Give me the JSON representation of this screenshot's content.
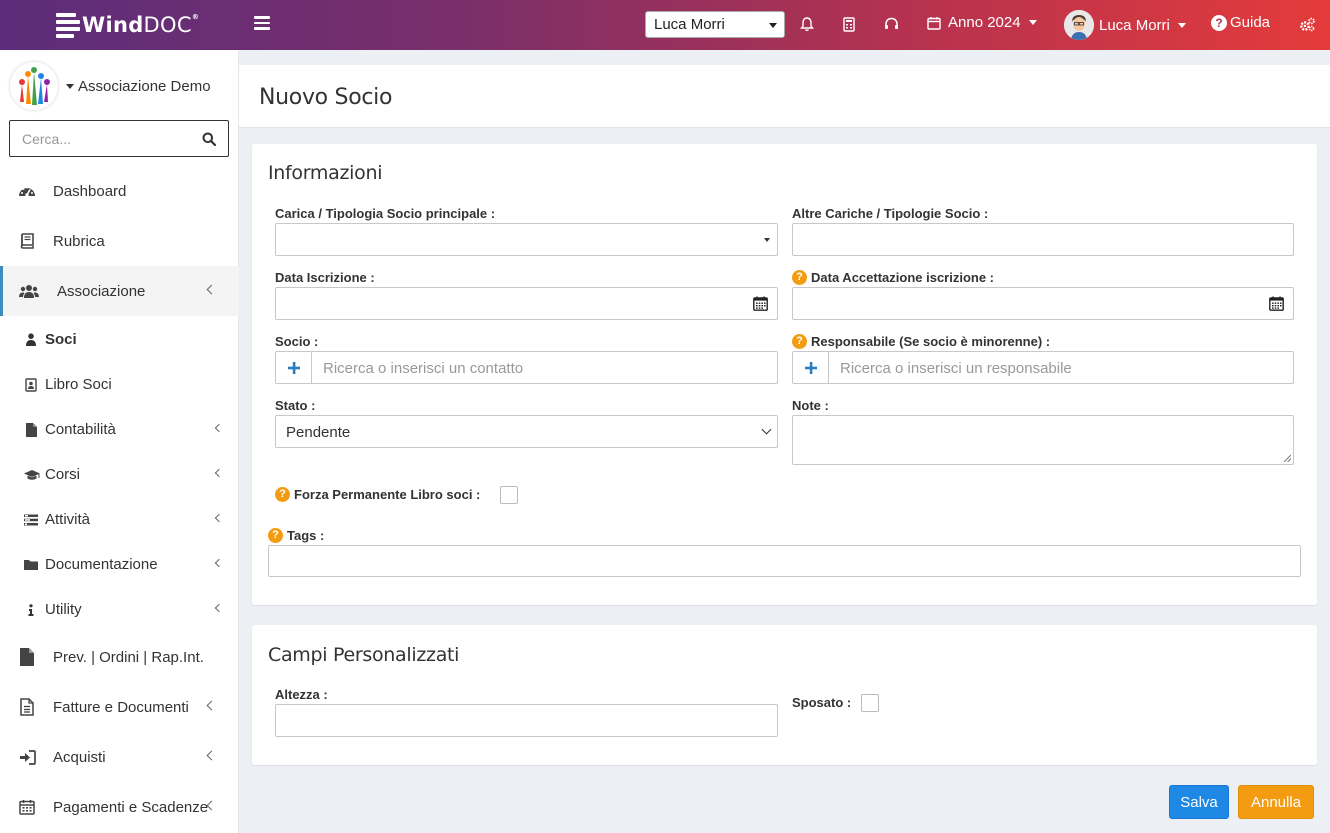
{
  "app": {
    "logo_main": "Wind",
    "logo_sub": "DOC",
    "logo_reg": "®"
  },
  "topbar": {
    "user_select_value": "Luca Morri",
    "year_label": "Anno 2024",
    "user_name": "Luca Morri",
    "help_label": "Guida"
  },
  "sidebar": {
    "org_name": "Associazione Demo",
    "search_placeholder": "Cerca...",
    "items": [
      {
        "label": "Dashboard"
      },
      {
        "label": "Rubrica"
      },
      {
        "label": "Associazione"
      },
      {
        "label": "Prev. | Ordini | Rap.Int."
      },
      {
        "label": "Fatture e Documenti"
      },
      {
        "label": "Acquisti"
      },
      {
        "label": "Pagamenti e Scadenze"
      }
    ],
    "sub_items": [
      {
        "label": "Soci"
      },
      {
        "label": "Libro Soci"
      },
      {
        "label": "Contabilità"
      },
      {
        "label": "Corsi"
      },
      {
        "label": "Attività"
      },
      {
        "label": "Documentazione"
      },
      {
        "label": "Utility"
      }
    ]
  },
  "page": {
    "title": "Nuovo Socio"
  },
  "info": {
    "title": "Informazioni",
    "carica_label": "Carica / Tipologia Socio principale :",
    "altre_label": "Altre Cariche / Tipologie Socio :",
    "data_iscr_label": "Data Iscrizione :",
    "data_acc_label": "Data Accettazione iscrizione :",
    "socio_label": "Socio :",
    "socio_placeholder": "Ricerca o inserisci un contatto",
    "resp_label": "Responsabile (Se socio è minorenne) :",
    "resp_placeholder": "Ricerca o inserisci un responsabile",
    "stato_label": "Stato :",
    "stato_value": "Pendente",
    "note_label": "Note :",
    "forza_label": "Forza Permanente Libro soci :",
    "tags_label": "Tags :",
    "help_glyph": "?"
  },
  "custom": {
    "title": "Campi Personalizzati",
    "altezza_label": "Altezza :",
    "sposato_label": "Sposato :"
  },
  "actions": {
    "save": "Salva",
    "cancel": "Annulla"
  },
  "colors": {
    "topbar_start": "#5c2d7a",
    "topbar_end": "#e43b3b",
    "primary": "#1e88e5",
    "warning": "#f39c12",
    "help_badge": "#f39c12"
  }
}
